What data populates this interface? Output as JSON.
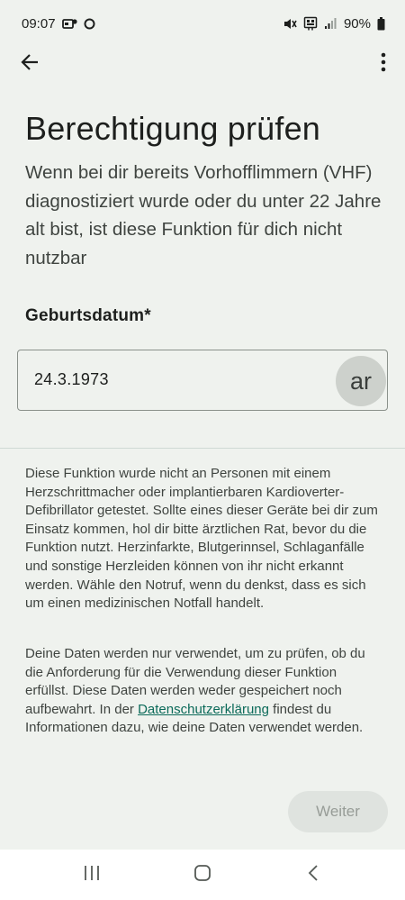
{
  "status_bar": {
    "time": "09:07",
    "battery": "90%"
  },
  "icons": {
    "back": "arrow-back-icon",
    "more": "more-vert-icon",
    "nav_recents": "recents-icon",
    "nav_home": "home-icon",
    "nav_back": "nav-back-icon"
  },
  "page": {
    "title": "Berechtigung prüfen",
    "subtitle": "Wenn bei dir bereits Vorhofflimmern (VHF) diagnostiziert wurde oder du unter 22 Jahre alt bist, ist diese Funktion für dich nicht nutzbar"
  },
  "birthdate": {
    "label": "Geburtsdatum*",
    "value": "24.3.1973",
    "badge": "ar"
  },
  "disclaimer": "Diese Funktion wurde nicht an Personen mit einem Herzschrittmacher oder implantierbaren Kardioverter-Defibrillator getestet. Sollte eines dieser Geräte bei dir zum Einsatz kommen, hol dir bitte ärztlichen Rat, bevor du die Funktion nutzt. Herzinfarkte, Blutgerinnsel, Schlaganfälle und sonstige Herzleiden können von ihr nicht erkannt werden. Wähle den Notruf, wenn du denkst, dass es sich um einen medizinischen Notfall handelt.",
  "privacy": {
    "before": "Deine Daten werden nur verwendet, um zu prüfen, ob du die Anforderung für die Verwendung dieser Funktion erfüllst. Diese Daten werden weder gespeichert noch aufbewahrt. In der ",
    "link": "Datenschutzerklärung",
    "after": " findest du Informationen dazu, wie deine Daten verwendet werden."
  },
  "actions": {
    "next_label": "Weiter"
  },
  "colors": {
    "background": "#eff2ee",
    "link": "#0b6a59",
    "button_disabled_bg": "#dfe3df",
    "button_disabled_text": "#979c97"
  }
}
